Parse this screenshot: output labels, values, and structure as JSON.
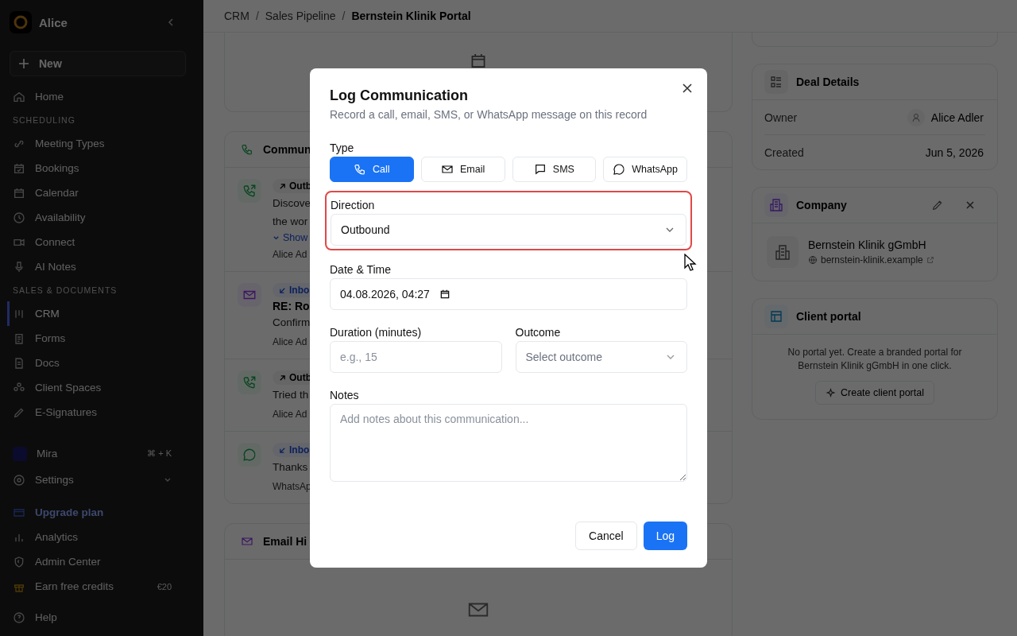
{
  "sidebar": {
    "workspace": "Alice",
    "new_button": "New",
    "items": [
      {
        "kind": "item",
        "label": "Home",
        "selected": false
      },
      {
        "kind": "heading",
        "label": "SCHEDULING"
      },
      {
        "kind": "item",
        "label": "Meeting Types",
        "selected": false
      },
      {
        "kind": "item",
        "label": "Bookings",
        "selected": false
      },
      {
        "kind": "item",
        "label": "Calendar",
        "selected": false
      },
      {
        "kind": "item",
        "label": "Availability",
        "selected": false
      },
      {
        "kind": "item",
        "label": "Connect",
        "selected": false
      },
      {
        "kind": "item",
        "label": "AI Notes",
        "selected": false
      },
      {
        "kind": "heading",
        "label": "SALES & DOCUMENTS"
      },
      {
        "kind": "item",
        "label": "CRM",
        "selected": true
      },
      {
        "kind": "item",
        "label": "Forms",
        "selected": false
      },
      {
        "kind": "item",
        "label": "Docs",
        "selected": false
      },
      {
        "kind": "item",
        "label": "Client Spaces",
        "selected": false
      },
      {
        "kind": "item",
        "label": "E-Signatures",
        "selected": false
      },
      {
        "kind": "assistant",
        "label": "Mira",
        "shortcut": "⌘ + K",
        "selected": false
      },
      {
        "kind": "group",
        "label": "Settings",
        "selected": false
      },
      {
        "kind": "upgrade",
        "label": "Upgrade plan",
        "selected": false
      },
      {
        "kind": "item",
        "label": "Analytics",
        "selected": false
      },
      {
        "kind": "item",
        "label": "Admin Center",
        "selected": false
      },
      {
        "kind": "credits",
        "label": "Earn free credits",
        "badge": "€20",
        "selected": false
      },
      {
        "kind": "item",
        "label": "Help",
        "selected": false
      }
    ]
  },
  "breadcrumb": [
    "CRM",
    "Sales Pipeline",
    "Bernstein Klinik Portal"
  ],
  "breadcrumb_separator": "/",
  "communications": {
    "title": "Commun",
    "entries": [
      {
        "kind": "call",
        "inbound": false,
        "badge": "Outb",
        "lines": [
          "Discove",
          "the wor"
        ],
        "toggle": "Show",
        "footer": "Alice Ad"
      },
      {
        "kind": "email",
        "inbound": true,
        "badge": "Inbo",
        "subject": "RE: Ro",
        "lines": [
          "Confirm"
        ],
        "footer": "Alice Ad"
      },
      {
        "kind": "call",
        "inbound": false,
        "badge": "Outb",
        "lines": [
          "Tried th"
        ],
        "footer": "Alice Ad"
      },
      {
        "kind": "whatsapp",
        "inbound": true,
        "badge": "Inbo",
        "lines": [
          "Thanks"
        ],
        "footer": "WhatsAp"
      }
    ]
  },
  "email_history": {
    "title": "Email Hi"
  },
  "deal_details": {
    "title": "Deal Details",
    "rows": [
      {
        "label": "Owner",
        "value": "Alice Adler",
        "kind": "person"
      },
      {
        "label": "Created",
        "value": "Jun 5, 2026",
        "kind": "text"
      }
    ]
  },
  "company": {
    "title": "Company",
    "name": "Bernstein Klinik gGmbH",
    "website": "bernstein-klinik.example"
  },
  "client_portal": {
    "title": "Client portal",
    "message": "No portal yet. Create a branded portal for Bernstein Klinik gGmbH in one click.",
    "button": "Create client portal"
  },
  "dialog": {
    "title": "Log Communication",
    "subtitle": "Record a call, email, SMS, or WhatsApp message on this record",
    "type_label": "Type",
    "types": [
      {
        "kind": "call",
        "label": "Call",
        "selected": true
      },
      {
        "kind": "email",
        "label": "Email",
        "selected": false
      },
      {
        "kind": "sms",
        "label": "SMS",
        "selected": false
      },
      {
        "kind": "whatsapp",
        "label": "WhatsApp",
        "selected": false
      }
    ],
    "direction": {
      "label": "Direction",
      "value": "Outbound",
      "highlighted": true
    },
    "date_time": {
      "label": "Date & Time",
      "value": "04.08.2026, 04:27"
    },
    "duration": {
      "label": "Duration (minutes)",
      "placeholder": "e.g., 15"
    },
    "outcome": {
      "label": "Outcome",
      "placeholder": "Select outcome"
    },
    "notes": {
      "label": "Notes",
      "placeholder": "Add notes about this communication..."
    },
    "cancel": "Cancel",
    "submit": "Log"
  }
}
